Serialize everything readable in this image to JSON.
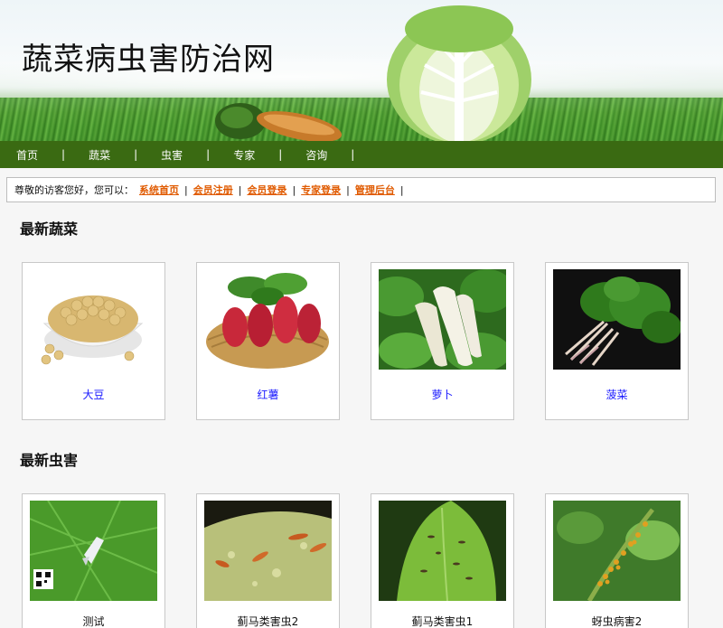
{
  "header": {
    "site_title": "蔬菜病虫害防治网"
  },
  "nav": {
    "items": [
      {
        "label": "首页"
      },
      {
        "label": "蔬菜"
      },
      {
        "label": "虫害"
      },
      {
        "label": "专家"
      },
      {
        "label": "咨询"
      }
    ],
    "separator": "|"
  },
  "welcome": {
    "greeting": "尊敬的访客您好，您可以：",
    "links": [
      {
        "label": "系统首页"
      },
      {
        "label": "会员注册"
      },
      {
        "label": "会员登录"
      },
      {
        "label": "专家登录"
      },
      {
        "label": "管理后台"
      }
    ],
    "separator": "|"
  },
  "sections": {
    "vegetables": {
      "title": "最新蔬菜",
      "items": [
        {
          "label": "大豆",
          "image": "soybean-photo"
        },
        {
          "label": "红薯",
          "image": "sweet-potato-photo"
        },
        {
          "label": "萝卜",
          "image": "radish-photo"
        },
        {
          "label": "菠菜",
          "image": "spinach-photo"
        }
      ]
    },
    "pests": {
      "title": "最新虫害",
      "items": [
        {
          "label": "测试",
          "image": "whitefly-leaf-photo"
        },
        {
          "label": "蓟马类害虫2",
          "image": "thrips-leaf-photo"
        },
        {
          "label": "蓟马类害虫1",
          "image": "thrips-green-leaf-photo"
        },
        {
          "label": "蚜虫病害2",
          "image": "aphid-stem-photo"
        }
      ]
    }
  },
  "colors": {
    "nav_bg": "#3a6a12",
    "link_orange": "#e05a00",
    "item_link_blue": "#1a1aff"
  }
}
